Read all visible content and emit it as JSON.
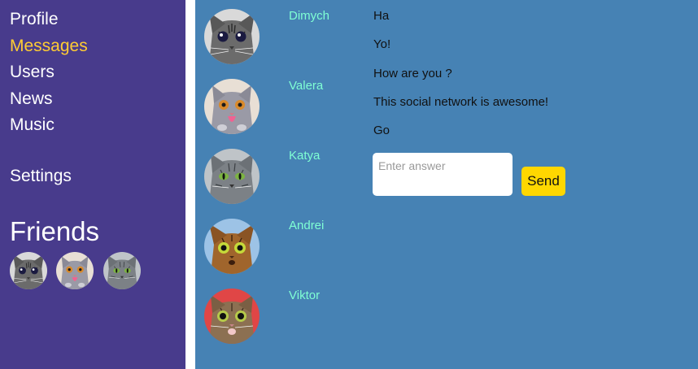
{
  "sidebar": {
    "nav": [
      {
        "label": "Profile",
        "active": false
      },
      {
        "label": "Messages",
        "active": true
      },
      {
        "label": "Users",
        "active": false
      },
      {
        "label": "News",
        "active": false
      },
      {
        "label": "Music",
        "active": false
      }
    ],
    "settings_label": "Settings",
    "friends_title": "Friends",
    "friends": [
      {
        "avatar": "gray-tabby-cat-icon"
      },
      {
        "avatar": "pink-tongue-kitten-icon"
      },
      {
        "avatar": "green-eyed-cat-icon"
      }
    ]
  },
  "dialogs": [
    {
      "name": "Dimych",
      "avatar": "gray-tabby-cat-icon"
    },
    {
      "name": "Valera",
      "avatar": "pink-tongue-kitten-icon"
    },
    {
      "name": "Katya",
      "avatar": "green-eyed-cat-icon"
    },
    {
      "name": "Andrei",
      "avatar": "surprised-orange-cat-icon"
    },
    {
      "name": "Viktor",
      "avatar": "shocked-cat-icon"
    }
  ],
  "messages": [
    "Ha",
    "Yo!",
    "How are you ?",
    "This social network is awesome!",
    "Go"
  ],
  "answer": {
    "placeholder": "Enter answer",
    "value": "",
    "send_label": "Send"
  },
  "colors": {
    "sidebar_bg": "#483b8c",
    "main_bg": "#4682b4",
    "active_nav": "#ffcc33",
    "dialog_name": "#7fffd4",
    "send_button": "#ffd700"
  }
}
